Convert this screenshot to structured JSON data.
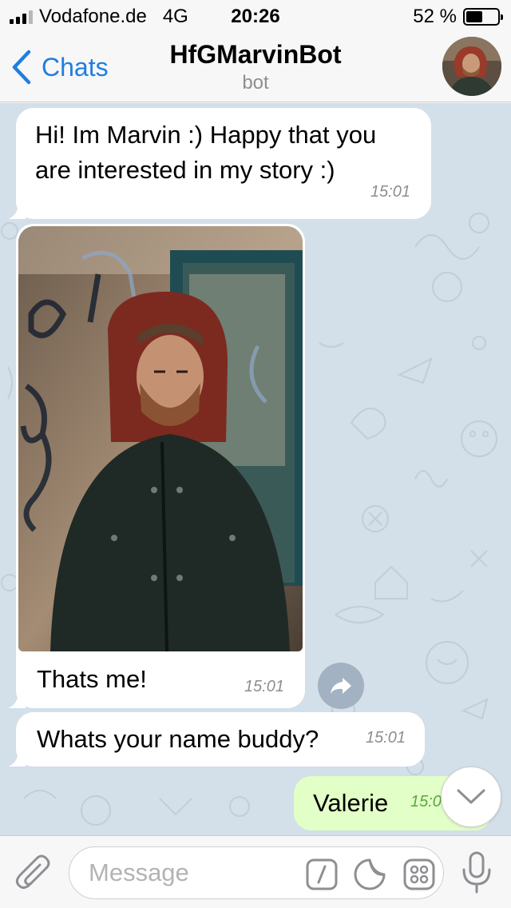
{
  "status_bar": {
    "carrier": "Vodafone.de",
    "network": "4G",
    "time": "20:26",
    "battery_text": "52 %",
    "battery_level": 0.52
  },
  "header": {
    "back_label": "Chats",
    "title": "HfGMarvinBot",
    "subtitle": "bot"
  },
  "messages": [
    {
      "text": "Hi! Im Marvin :) Happy that you are interested in my story :)",
      "time": "15:01",
      "direction": "incoming"
    },
    {
      "type": "photo",
      "caption": "Thats me!",
      "time": "15:01",
      "direction": "incoming"
    },
    {
      "text": "Whats your name buddy?",
      "time": "15:01",
      "direction": "incoming"
    },
    {
      "text": "Valerie",
      "time": "15:0",
      "direction": "outgoing"
    }
  ],
  "input": {
    "placeholder": "Message"
  },
  "colors": {
    "accent": "#1f7ee0",
    "chat_background": "#d3dfe9",
    "outgoing_bubble": "#e2ffc7",
    "incoming_bubble": "#ffffff"
  },
  "icons": [
    "back-chevron-icon",
    "share-icon",
    "scroll-down-chevron-icon",
    "paperclip-icon",
    "slash-command-icon",
    "sticker-icon",
    "bot-keyboard-icon",
    "microphone-icon"
  ]
}
